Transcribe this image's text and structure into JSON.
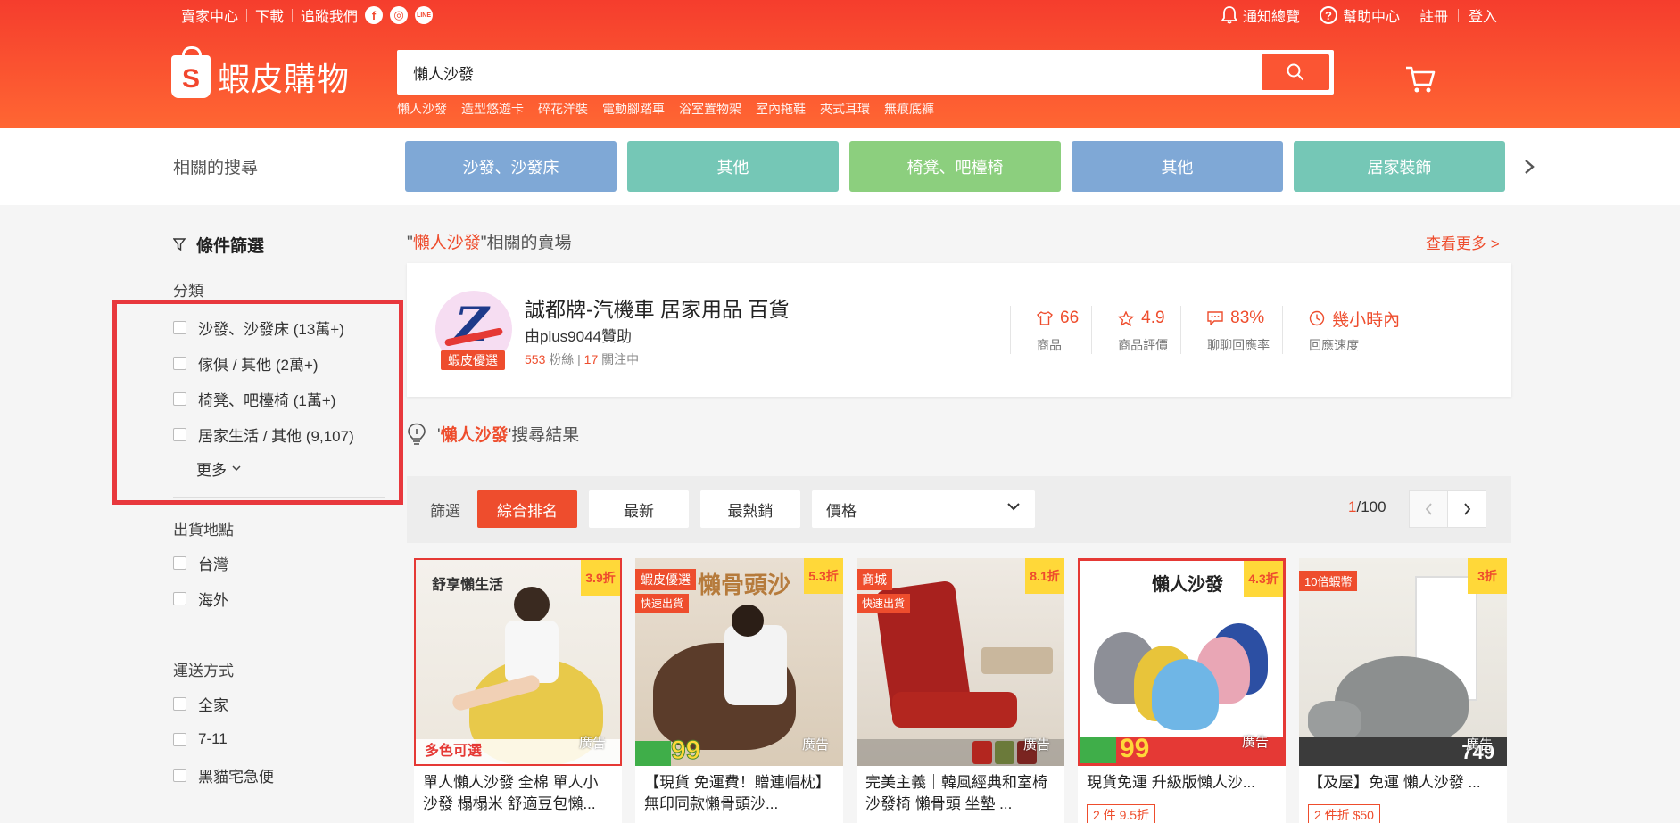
{
  "topbar": {
    "left_links": [
      "賣家中心",
      "下載",
      "追蹤我們"
    ],
    "social": [
      "f",
      "◎",
      "LINE"
    ],
    "notifications": "通知總覽",
    "help": "幫助中心",
    "register": "註冊",
    "login": "登入"
  },
  "brand": {
    "logo_letter": "S",
    "name": "蝦皮購物",
    "color": "#ee4d2d"
  },
  "search": {
    "value": "懶人沙發",
    "hotwords": [
      "懶人沙發",
      "造型悠遊卡",
      "碎花洋裝",
      "電動腳踏車",
      "浴室置物架",
      "室內拖鞋",
      "夾式耳環",
      "無痕底褲"
    ]
  },
  "related": {
    "title": "相關的搜尋",
    "categories": [
      {
        "label": "沙發、沙發床",
        "color": "#7fa8d6"
      },
      {
        "label": "其他",
        "color": "#75c7b6"
      },
      {
        "label": "椅凳、吧檯椅",
        "color": "#8ccf7e"
      },
      {
        "label": "其他",
        "color": "#7fa8d6"
      },
      {
        "label": "居家裝飾",
        "color": "#75c7b6"
      }
    ]
  },
  "sidebar": {
    "filter_title": "條件篩選",
    "category_label": "分類",
    "categories": [
      "沙發、沙發床 (13萬+)",
      "傢俱 / 其他 (2萬+)",
      "椅凳、吧檯椅 (1萬+)",
      "居家生活 / 其他 (9,107)"
    ],
    "more": "更多",
    "location_label": "出貨地點",
    "locations": [
      "台灣",
      "海外"
    ],
    "shipping_label": "運送方式",
    "shipping": [
      "全家",
      "7-11",
      "黑貓宅急便"
    ]
  },
  "shop_section": {
    "title_quote_open": "\"",
    "keyword": "懶人沙發",
    "title_suffix": "\"相關的賣場",
    "see_more": "查看更多 >",
    "shop": {
      "badge": "蝦皮優選",
      "name": "誠都牌-汽機車 居家用品 百貨",
      "sponsor": "由plus9044贊助",
      "followers": "553",
      "followers_label": "粉絲 |",
      "following": "17",
      "following_label": "關注中",
      "stats": [
        {
          "value": "66",
          "label": "商品",
          "icon": "shirt-icon"
        },
        {
          "value": "4.9",
          "label": "商品評價",
          "icon": "star-icon"
        },
        {
          "value": "83%",
          "label": "聊聊回應率",
          "icon": "chat-icon"
        },
        {
          "value": "幾小時內",
          "label": "回應速度",
          "icon": "clock-icon"
        }
      ]
    }
  },
  "results": {
    "quote_open": "'",
    "keyword": "懶人沙發",
    "suffix": "'搜尋結果"
  },
  "sortbar": {
    "label": "篩選",
    "options": [
      "綜合排名",
      "最新",
      "最熱銷"
    ],
    "price": "價格",
    "page_current": "1",
    "page_total": "/100"
  },
  "products": [
    {
      "title": "單人懶人沙發 全棉 單人小沙發 榻榻米 舒適豆包懶...",
      "discount": "3.9折",
      "ad": "廣告",
      "tag1": "",
      "tag2": "",
      "promo": "",
      "img_text": "舒享懶生活",
      "img_text2": "多色可選"
    },
    {
      "title": "【現貨 免運費！贈連帽枕】無印同款懶骨頭沙...",
      "discount": "5.3折",
      "ad": "廣告",
      "tag1": "蝦皮優選",
      "tag2": "快速出貨",
      "promo": "",
      "img_text": "懶骨頭沙",
      "img_text2": "99"
    },
    {
      "title": "完美主義｜韓風經典和室椅 沙發椅 懶骨頭 坐墊 ...",
      "discount": "8.1折",
      "ad": "廣告",
      "tag1": "商城",
      "tag2": "快速出貨",
      "promo": "",
      "img_text": "",
      "img_text2": ""
    },
    {
      "title": "現貨免運 升級版懶人沙...",
      "discount": "4.3折",
      "ad": "廣告",
      "tag1": "",
      "tag2": "",
      "promo": "2 件 9.5折",
      "img_text": "懶人沙發",
      "img_text2": "99"
    },
    {
      "title": "【及屋】免運 懶人沙發 ...",
      "discount": "3折",
      "ad": "廣告",
      "tag1": "10倍蝦幣",
      "tag2": "",
      "promo": "2 件折 $50",
      "img_text": "",
      "img_text2": "749"
    }
  ]
}
